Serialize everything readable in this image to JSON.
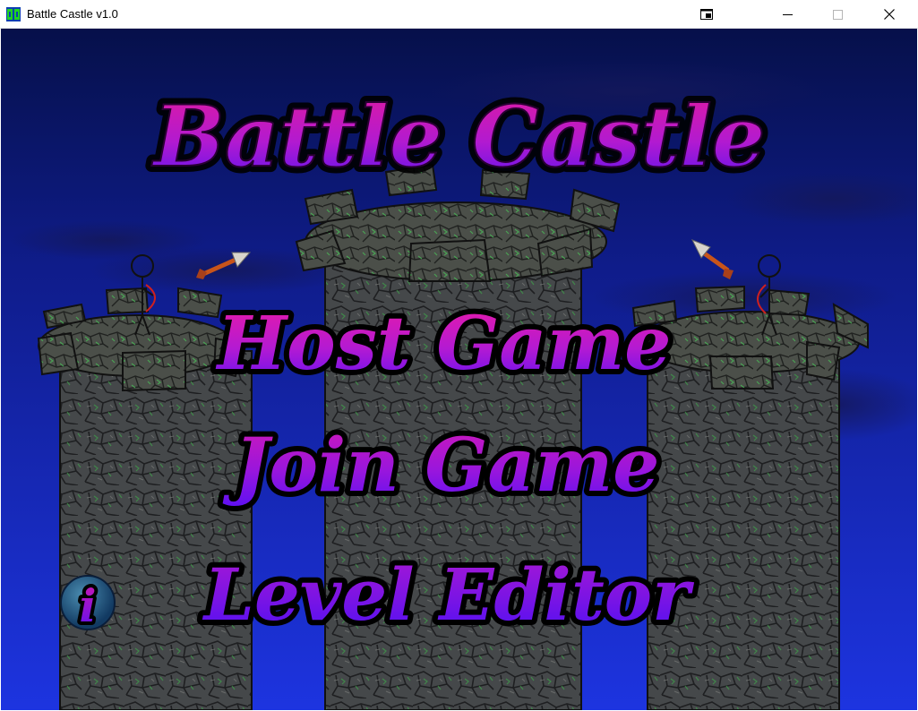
{
  "window": {
    "title": "Battle Castle v1.0",
    "app_icon": "battle-castle-app-icon",
    "controls": [
      "restore-window-icon",
      "minimize-icon",
      "maximize-icon",
      "close-icon"
    ]
  },
  "game": {
    "logo_text": "Battle Castle",
    "menu": {
      "host_label": "Host Game",
      "join_label": "Join Game",
      "editor_label": "Level Editor"
    },
    "info_button_glyph": "i",
    "info_icon": "info-icon",
    "colors": {
      "sky_top": "#06104a",
      "sky_bottom": "#1a2fd6",
      "title_magenta": "#d81aa8",
      "title_violet": "#6a10e8",
      "stone": "#4a4d48",
      "stone_moss": "#2f7a3a",
      "archer_bow": "#d0201e",
      "arrow_shaft": "#c8541a"
    }
  }
}
